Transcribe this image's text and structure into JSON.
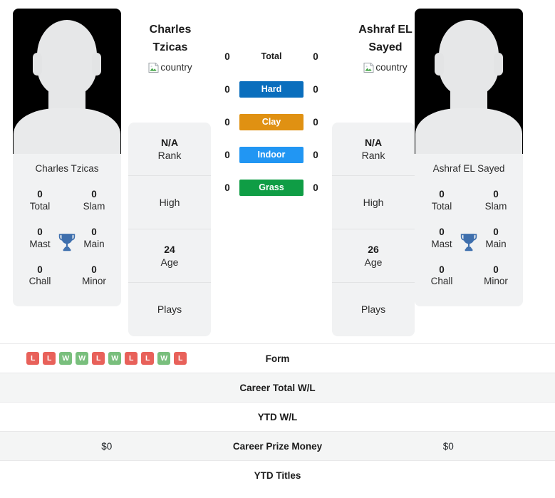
{
  "players": {
    "left": {
      "name": "Charles Tzicas",
      "name_line1": "Charles",
      "name_line2": "Tzicas",
      "flag_alt": "country",
      "rank_value": "N/A",
      "rank_label": "Rank",
      "high_value": "",
      "high_label": "High",
      "age_value": "24",
      "age_label": "Age",
      "plays_value": "",
      "plays_label": "Plays",
      "titles": [
        {
          "value": "0",
          "label": "Total"
        },
        {
          "value": "0",
          "label": "Slam"
        },
        {
          "value": "0",
          "label": "Mast"
        },
        {
          "value": "0",
          "label": "Main"
        },
        {
          "value": "0",
          "label": "Chall"
        },
        {
          "value": "0",
          "label": "Minor"
        }
      ],
      "surface_values": {
        "total": "0",
        "hard": "0",
        "clay": "0",
        "indoor": "0",
        "grass": "0"
      },
      "form": [
        "L",
        "L",
        "W",
        "W",
        "L",
        "W",
        "L",
        "L",
        "W",
        "L"
      ],
      "career_total_wl": "",
      "ytd_wl": "",
      "career_prize_money": "$0",
      "ytd_titles": ""
    },
    "right": {
      "name": "Ashraf EL Sayed",
      "name_line1": "Ashraf EL",
      "name_line2": "Sayed",
      "flag_alt": "country",
      "rank_value": "N/A",
      "rank_label": "Rank",
      "high_value": "",
      "high_label": "High",
      "age_value": "26",
      "age_label": "Age",
      "plays_value": "",
      "plays_label": "Plays",
      "titles": [
        {
          "value": "0",
          "label": "Total"
        },
        {
          "value": "0",
          "label": "Slam"
        },
        {
          "value": "0",
          "label": "Mast"
        },
        {
          "value": "0",
          "label": "Main"
        },
        {
          "value": "0",
          "label": "Chall"
        },
        {
          "value": "0",
          "label": "Minor"
        }
      ],
      "surface_values": {
        "total": "0",
        "hard": "0",
        "clay": "0",
        "indoor": "0",
        "grass": "0"
      },
      "form": [],
      "career_total_wl": "",
      "ytd_wl": "",
      "career_prize_money": "$0",
      "ytd_titles": ""
    }
  },
  "surfaces": [
    {
      "key": "total",
      "label": "Total",
      "color": "transparent",
      "plain": true
    },
    {
      "key": "hard",
      "label": "Hard",
      "color": "#0a6ebd",
      "plain": false
    },
    {
      "key": "clay",
      "label": "Clay",
      "color": "#e09112",
      "plain": false
    },
    {
      "key": "indoor",
      "label": "Indoor",
      "color": "#2196f3",
      "plain": false
    },
    {
      "key": "grass",
      "label": "Grass",
      "color": "#0f9d45",
      "plain": false
    }
  ],
  "comparison_rows": [
    {
      "key": "form",
      "label": "Form"
    },
    {
      "key": "career_total_wl",
      "label": "Career Total W/L"
    },
    {
      "key": "ytd_wl",
      "label": "YTD W/L"
    },
    {
      "key": "career_prize_money",
      "label": "Career Prize Money"
    },
    {
      "key": "ytd_titles",
      "label": "YTD Titles"
    }
  ],
  "colors": {
    "win": "#79bf7d",
    "loss": "#e8615a",
    "trophy": "#3e6fad",
    "card_bg": "#f1f2f3",
    "alt_row": "#f4f5f5"
  },
  "icons": {
    "trophy": "trophy-icon",
    "broken_image": "broken-image-icon"
  }
}
